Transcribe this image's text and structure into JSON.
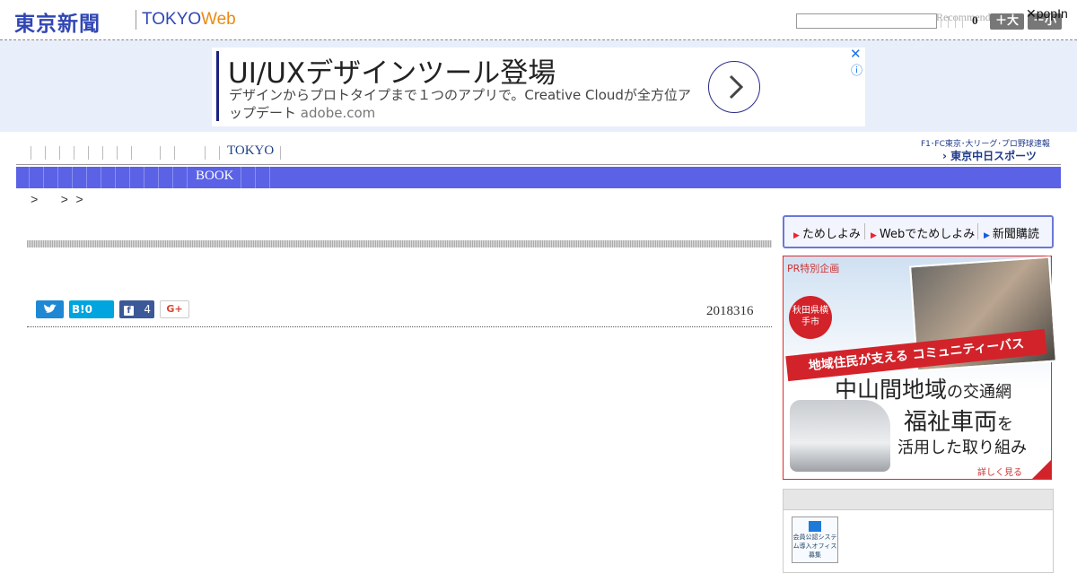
{
  "header": {
    "logo_jp": "東京新聞",
    "logo_tokyo": "TOKYO",
    "logo_web": "Web",
    "recommend": "Recommend",
    "count": "0",
    "font_large": "＋大",
    "font_small": "－小",
    "popin": "✕popIn"
  },
  "ad": {
    "title": "UI/UXデザインツール登場",
    "description": "デザインからプロトタイプまで１つのアプリで。Creative Cloudが全方位アップデート",
    "domain": "adobe.com",
    "close": "✕",
    "info": "ⓘ"
  },
  "nav": {
    "tokyo": "TOKYO",
    "f1_text": "F1･FC東京･大リーグ･プロ野球速報",
    "chunichi": "東京中日スポーツ",
    "book": "BOOK"
  },
  "breadcrumb": ">   > >",
  "article": {
    "date": "2018316",
    "share": {
      "twitter": "",
      "hatena": "B!0",
      "facebook_count": "4",
      "google": "G+"
    }
  },
  "sidebar": {
    "tame_items": [
      "ためしよみ",
      "Webでためしよみ",
      "新聞購読"
    ],
    "pr": {
      "special": "PR特別企画",
      "badge": "秋田県横手市",
      "ribbon": "地域住民が支える コミュニティーバス",
      "h1_big": "中山間地域",
      "h1_small": "の交通網",
      "h2_big": "福祉車両",
      "h2_small": "を",
      "h3": "活用した取り組み",
      "more": "詳しく見る"
    },
    "sys_logo": "会員公認システム導入オフィス募集"
  },
  "colors": {
    "brand_blue": "#3146b4",
    "web_orange": "#ea8a12",
    "nav_blue": "#5b62e6",
    "pr_red": "#d2232a"
  }
}
